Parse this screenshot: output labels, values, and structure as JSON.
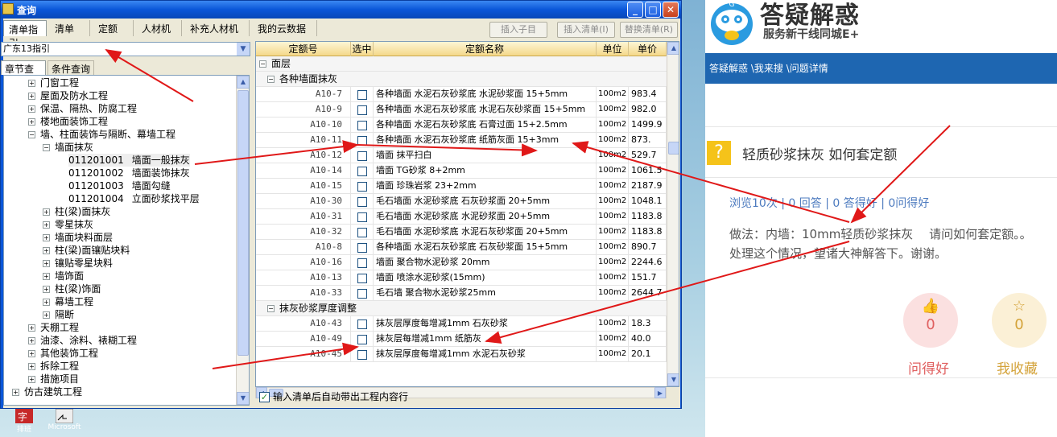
{
  "window": {
    "title": "查询"
  },
  "top_tabs": [
    "清单指引",
    "清单",
    "定额",
    "人材机",
    "补充人材机",
    "我的云数据"
  ],
  "toolbar": {
    "insert_child": "插入子目",
    "insert_list": "插入清单(I)",
    "replace_list": "替换清单(R)"
  },
  "region_select": "广东13指引",
  "sub_tabs": [
    "章节查询",
    "条件查询"
  ],
  "tree": [
    {
      "label": "门窗工程",
      "pm": "+"
    },
    {
      "label": "屋面及防水工程",
      "pm": "+"
    },
    {
      "label": "保温、隔热、防腐工程",
      "pm": "+"
    },
    {
      "label": "楼地面装饰工程",
      "pm": "+"
    },
    {
      "label": "墙、柱面装饰与隔断、幕墙工程",
      "pm": "−"
    },
    {
      "label": "墙面抹灰",
      "pm": "−"
    },
    {
      "code": "011201001",
      "label": "墙面一般抹灰"
    },
    {
      "code": "011201002",
      "label": "墙面装饰抹灰"
    },
    {
      "code": "011201003",
      "label": "墙面勾缝"
    },
    {
      "code": "011201004",
      "label": "立面砂浆找平层"
    },
    {
      "label": "柱(梁)面抹灰",
      "pm": "+"
    },
    {
      "label": "零星抹灰",
      "pm": "+"
    },
    {
      "label": "墙面块料面层",
      "pm": "+"
    },
    {
      "label": "柱(梁)面镶贴块料",
      "pm": "+"
    },
    {
      "label": "镶贴零星块料",
      "pm": "+"
    },
    {
      "label": "墙饰面",
      "pm": "+"
    },
    {
      "label": "柱(梁)饰面",
      "pm": "+"
    },
    {
      "label": "幕墙工程",
      "pm": "+"
    },
    {
      "label": "隔断",
      "pm": "+"
    },
    {
      "label": "天棚工程",
      "pm": "+"
    },
    {
      "label": "油漆、涂料、裱糊工程",
      "pm": "+"
    },
    {
      "label": "其他装饰工程",
      "pm": "+"
    },
    {
      "label": "拆除工程",
      "pm": "+"
    },
    {
      "label": "措施项目",
      "pm": "+"
    },
    {
      "label": "仿古建筑工程",
      "pm": "+"
    }
  ],
  "grid": {
    "headers": [
      "定额号",
      "选中",
      "定额名称",
      "单位",
      "单价"
    ],
    "group_top": "面层",
    "group1": "各种墙面抹灰",
    "rows1": [
      {
        "code": "A10-7",
        "name": "各种墙面 水泥石灰砂浆底 水泥砂浆面 15+5mm",
        "unit": "100m2",
        "price": "983.4"
      },
      {
        "code": "A10-9",
        "name": "各种墙面 水泥石灰砂浆底 水泥石灰砂浆面 15+5mm",
        "unit": "100m2",
        "price": "982.0"
      },
      {
        "code": "A10-10",
        "name": "各种墙面 水泥石灰砂浆底 石膏过面 15+2.5mm",
        "unit": "100m2",
        "price": "1499.9"
      },
      {
        "code": "A10-11",
        "name": "各种墙面 水泥石灰砂浆底 纸筋灰面 15+3mm",
        "unit": "100m2",
        "price": "873."
      },
      {
        "code": "A10-12",
        "name": "墙面 抹平扫白",
        "unit": "100m2",
        "price": "529.7"
      },
      {
        "code": "A10-14",
        "name": "墙面 TG砂浆 8+2mm",
        "unit": "100m2",
        "price": "1061.5"
      },
      {
        "code": "A10-15",
        "name": "墙面 珍珠岩浆 23+2mm",
        "unit": "100m2",
        "price": "2187.9"
      },
      {
        "code": "A10-30",
        "name": "毛石墙面 水泥砂浆底 石灰砂浆面 20+5mm",
        "unit": "100m2",
        "price": "1048.1"
      },
      {
        "code": "A10-31",
        "name": "毛石墙面 水泥砂浆底 水泥砂浆面 20+5mm",
        "unit": "100m2",
        "price": "1183.8"
      },
      {
        "code": "A10-32",
        "name": "毛石墙面 水泥砂浆底 水泥石灰砂浆面 20+5mm",
        "unit": "100m2",
        "price": "1183.8"
      },
      {
        "code": "A10-8",
        "name": "各种墙面 水泥石灰砂浆底 石灰砂浆面 15+5mm",
        "unit": "100m2",
        "price": "890.7"
      },
      {
        "code": "A10-16",
        "name": "墙面 聚合物水泥砂浆 20mm",
        "unit": "100m2",
        "price": "2244.6"
      },
      {
        "code": "A10-13",
        "name": "墙面 喷涂水泥砂浆(15mm)",
        "unit": "100m2",
        "price": "151.7"
      },
      {
        "code": "A10-33",
        "name": "毛石墙 聚合物水泥砂浆25mm",
        "unit": "100m2",
        "price": "2644.7"
      }
    ],
    "group2": "抹灰砂浆厚度调整",
    "rows2": [
      {
        "code": "A10-43",
        "name": "抹灰层厚度每增减1mm 石灰砂浆",
        "unit": "100m2",
        "price": "18.3"
      },
      {
        "code": "A10-49",
        "name": "抹灰层每增减1mm 纸筋灰",
        "unit": "100m2",
        "price": "40.0"
      },
      {
        "code": "A10-45",
        "name": "抹灰层厚度每增减1mm 水泥石灰砂浆",
        "unit": "100m2",
        "price": "20.1"
      }
    ]
  },
  "auto_checkbox": "输入清单后自动带出工程内容行",
  "desktop_icons": [
    "排班",
    "Microsoft"
  ],
  "web": {
    "brand_title": "答疑解惑",
    "slogan": "服务新干线同城E+",
    "mascot_letter": "G",
    "breadcrumb": "答疑解惑 \\我来搜 \\问题详情",
    "question_icon": "?",
    "question_title": "轻质砂浆抹灰 如何套定额",
    "stats": "浏览10次 | 0 回答 | 0 答得好 | 0问得好",
    "body_line1": "做法：内墙：10mm轻质砂浆抹灰　 请问如何套定额。。",
    "body_line2": "处理这个情况，望诸大神解答下。谢谢。",
    "good_count": "0",
    "fav_count": "0",
    "good_label": "问得好",
    "fav_label": "我收藏"
  },
  "colors": {
    "title_blue": "#0a56d8",
    "nav_blue": "#1e66b1",
    "good_red": "#e06060",
    "fav_gold": "#d4a33a",
    "arrow_red": "#e01818"
  }
}
